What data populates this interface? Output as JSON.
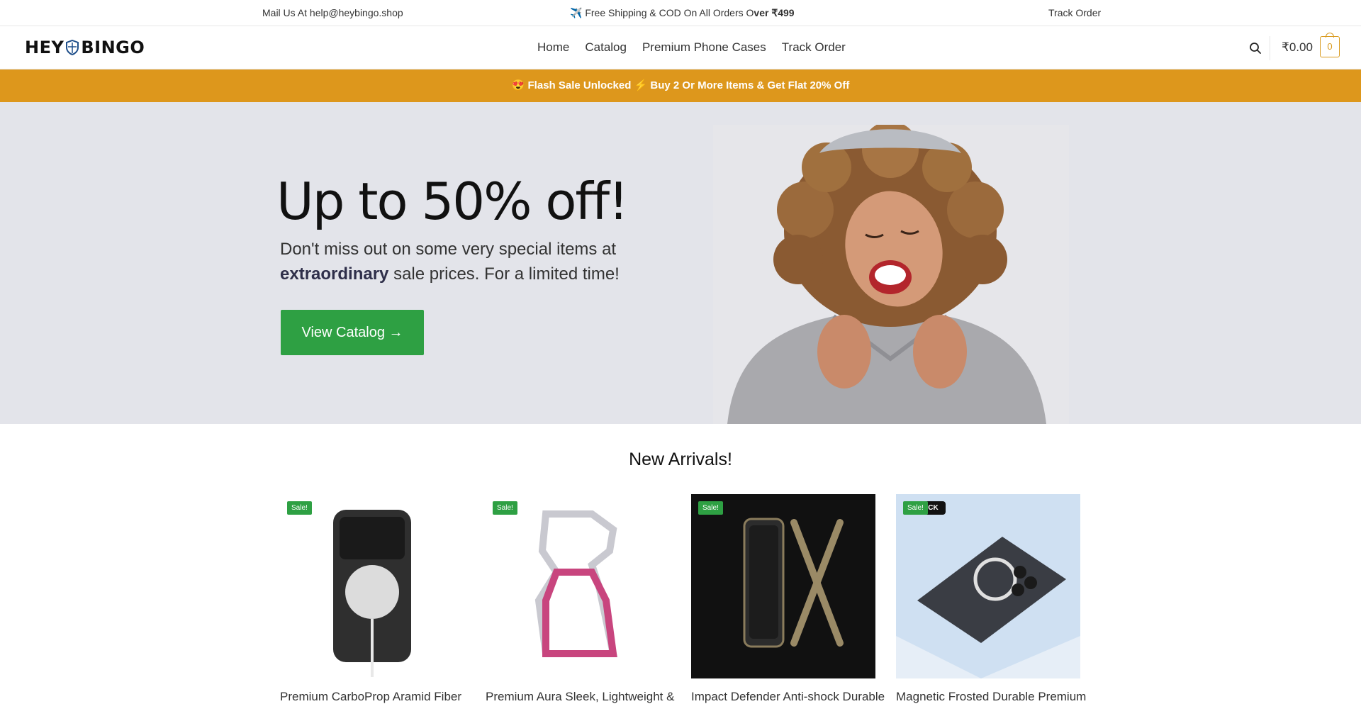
{
  "topbar": {
    "mail": "Mail Us At help@heybingo.shop",
    "shipping_prefix": "✈️ Free Shipping & COD On All Orders O",
    "shipping_bold": "ver ₹499",
    "track": "Track Order"
  },
  "header": {
    "logo_left": "HEY",
    "logo_right": "BINGO",
    "nav": [
      "Home",
      "Catalog",
      "Premium Phone Cases",
      "Track Order"
    ],
    "cart_total": "₹0.00",
    "cart_count": "0"
  },
  "flash": {
    "text": "😍 Flash Sale Unlocked ⚡ Buy 2 Or More Items & Get Flat 20% Off"
  },
  "hero": {
    "headline": "Up to 50% off!",
    "sub_prefix": "Don't miss out on some very special items at ",
    "sub_bold": "extraordinary",
    "sub_suffix": " sale prices. For a limited time!",
    "cta": "View Catalog →"
  },
  "arrivals": {
    "title": "New Arrivals!",
    "products": [
      {
        "name": "Premium CarboProp Aramid Fiber",
        "badge": "Sale!"
      },
      {
        "name": "Premium Aura Sleek, Lightweight &",
        "badge": "Sale!"
      },
      {
        "name": "Impact Defender Anti-shock Durable",
        "badge": "Sale!"
      },
      {
        "name": "Magnetic Frosted Durable Premium",
        "badge": "Sale!",
        "badge_extra": "ACK"
      }
    ]
  },
  "colors": {
    "accent": "#dd971c",
    "cta_green": "#2ea043",
    "hero_bg": "#e3e4ea"
  }
}
